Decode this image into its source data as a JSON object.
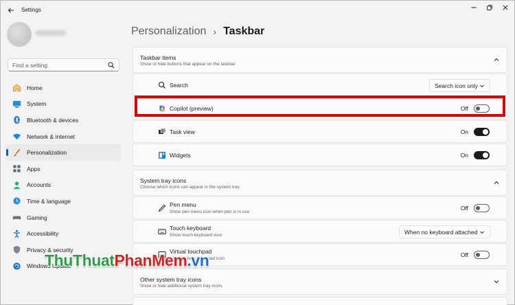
{
  "app": {
    "title": "Settings"
  },
  "sidebar": {
    "search_placeholder": "Find a setting",
    "items": [
      {
        "label": "Home",
        "icon": "home-icon"
      },
      {
        "label": "System",
        "icon": "monitor-icon"
      },
      {
        "label": "Bluetooth & devices",
        "icon": "bluetooth-icon"
      },
      {
        "label": "Network & internet",
        "icon": "wifi-icon"
      },
      {
        "label": "Personalization",
        "icon": "brush-icon",
        "active": true
      },
      {
        "label": "Apps",
        "icon": "apps-icon"
      },
      {
        "label": "Accounts",
        "icon": "person-icon"
      },
      {
        "label": "Time & language",
        "icon": "globe-clock-icon"
      },
      {
        "label": "Gaming",
        "icon": "gamepad-icon"
      },
      {
        "label": "Accessibility",
        "icon": "accessibility-icon"
      },
      {
        "label": "Privacy & security",
        "icon": "shield-icon"
      },
      {
        "label": "Windows Update",
        "icon": "update-icon"
      }
    ]
  },
  "breadcrumb": {
    "parent": "Personalization",
    "separator": "›",
    "current": "Taskbar"
  },
  "taskbar_items": {
    "title": "Taskbar items",
    "subtitle": "Show or hide buttons that appear on the taskbar",
    "rows": [
      {
        "label": "Search",
        "control": "dropdown",
        "value": "Search icon only"
      },
      {
        "label": "Copilot (preview)",
        "control": "toggle",
        "state": "Off"
      },
      {
        "label": "Task view",
        "control": "toggle",
        "state": "On"
      },
      {
        "label": "Widgets",
        "control": "toggle",
        "state": "On"
      }
    ]
  },
  "system_tray": {
    "title": "System tray icons",
    "subtitle": "Choose which icons can appear in the system tray",
    "rows": [
      {
        "label": "Pen menu",
        "sublabel": "Show pen menu icon when pen is in use",
        "control": "toggle",
        "state": "Off"
      },
      {
        "label": "Touch keyboard",
        "sublabel": "Show touch keyboard icon",
        "control": "dropdown",
        "value": "When no keyboard attached"
      },
      {
        "label": "Virtual touchpad",
        "sublabel": "Always show touchpad icon",
        "control": "toggle",
        "state": "Off"
      }
    ]
  },
  "other_tray": {
    "title": "Other system tray icons",
    "subtitle": "Show or hide additional system tray icons"
  },
  "watermark": {
    "part1": "ThuThuat",
    "part2": "PhanMem",
    "part3": ".vn"
  },
  "colors": {
    "accent": "#005fb8",
    "highlight": "#e00000",
    "toggle_on": "#1b1b1b"
  }
}
